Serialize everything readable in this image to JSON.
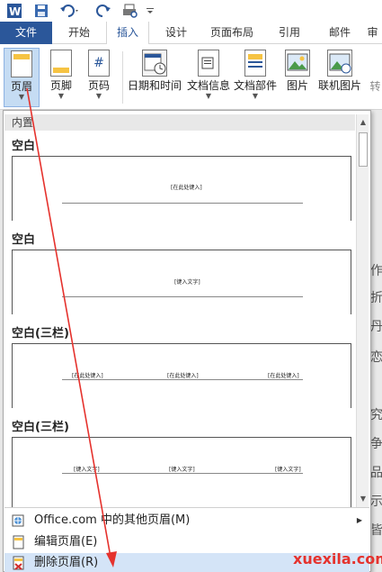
{
  "tabs": [
    {
      "label": "文件"
    },
    {
      "label": "开始"
    },
    {
      "label": "插入"
    },
    {
      "label": "设计"
    },
    {
      "label": "页面布局"
    },
    {
      "label": "引用"
    },
    {
      "label": "邮件"
    },
    {
      "label": "审"
    }
  ],
  "ribbon": {
    "buttons": [
      {
        "label": "页眉",
        "icon": "header-icon"
      },
      {
        "label": "页脚",
        "icon": "footer-icon"
      },
      {
        "label": "页码",
        "icon": "page-number-icon"
      },
      {
        "label": "日期和时间",
        "icon": "calendar-icon"
      },
      {
        "label": "文档信息",
        "icon": "document-info-icon"
      },
      {
        "label": "文档部件",
        "icon": "document-parts-icon"
      },
      {
        "label": "图片",
        "icon": "picture-icon"
      },
      {
        "label": "联机图片",
        "icon": "online-picture-icon"
      },
      {
        "label": "转"
      }
    ],
    "page_number_glyph": "#"
  },
  "gallery": {
    "section": "内置",
    "items": [
      {
        "label": "空白",
        "placeholders": [
          "[在此处键入]"
        ]
      },
      {
        "label": "空白",
        "placeholders": [
          "[键入文字]"
        ]
      },
      {
        "label": "空白(三栏)",
        "placeholders": [
          "[在此处键入]",
          "[在此处键入]",
          "[在此处键入]"
        ]
      },
      {
        "label": "空白(三栏)",
        "placeholders": [
          "[键入文字]",
          "[键入文字]",
          "[键入文字]"
        ]
      }
    ]
  },
  "menu": [
    {
      "label": "Office.com 中的其他页眉(M)",
      "icon": "office-online-icon",
      "has_submenu": true,
      "submenu_glyph": "▶"
    },
    {
      "label": "编辑页眉(E)",
      "icon": "edit-header-icon"
    },
    {
      "label": "删除页眉(R)",
      "icon": "delete-header-icon"
    }
  ],
  "doc_chars": [
    "作",
    "折",
    "丹",
    "恋",
    "究",
    "争",
    "品",
    "示",
    "皆"
  ],
  "watermark": "xuexila.com",
  "colors": {
    "accent": "#2b579a",
    "highlight": "#c5dcf3",
    "arrow": "#e5322d"
  }
}
